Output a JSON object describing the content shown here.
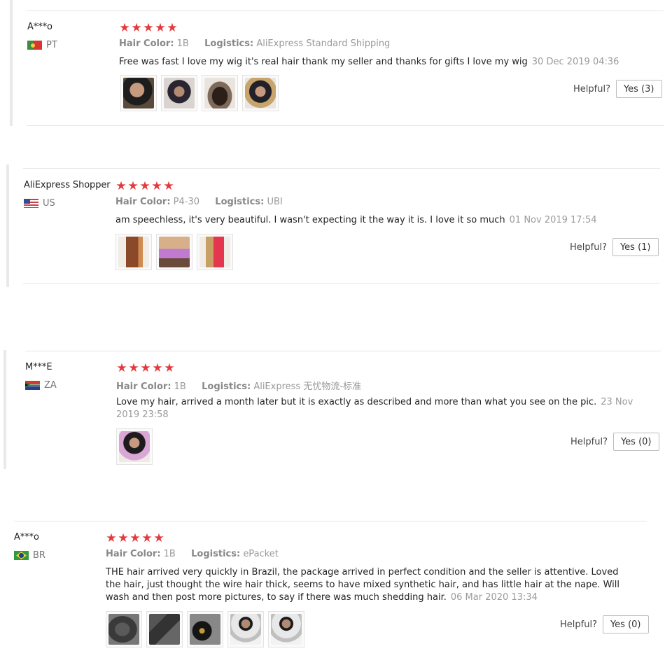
{
  "reviews": [
    {
      "user": "A***o",
      "country_code": "PT",
      "flag": "portugal-flag",
      "stars": 5,
      "attrs": [
        {
          "key": "Hair Color:",
          "value": "1B"
        },
        {
          "key": "Logistics:",
          "value": "AliExpress Standard Shipping"
        }
      ],
      "text": "Free was fast I love my wig it's real hair thank my seller and thanks for gifts I love my wig",
      "date": "30 Dec 2019 04:36",
      "photo_count": 4,
      "helpful_label": "Helpful?",
      "yes_label": "Yes (3)"
    },
    {
      "user": "AliExpress Shopper",
      "country_code": "US",
      "flag": "usa-flag",
      "stars": 5,
      "attrs": [
        {
          "key": "Hair Color:",
          "value": "P4-30"
        },
        {
          "key": "Logistics:",
          "value": "UBI"
        }
      ],
      "text": "am speechless, it's very beautiful. I wasn't expecting it the way it is. I love it so much",
      "date": "01 Nov 2019 17:54",
      "photo_count": 3,
      "helpful_label": "Helpful?",
      "yes_label": "Yes (1)"
    },
    {
      "user": "M***E",
      "country_code": "ZA",
      "flag": "south-africa-flag",
      "stars": 5,
      "attrs": [
        {
          "key": "Hair Color:",
          "value": "1B"
        },
        {
          "key": "Logistics:",
          "value": "AliExpress 无忧物流-标准"
        }
      ],
      "text": "Love my hair, arrived a month later but it is exactly as described and more than what you see on the pic.",
      "date": "23 Nov 2019 23:58",
      "photo_count": 1,
      "helpful_label": "Helpful?",
      "yes_label": "Yes (0)"
    },
    {
      "user": "A***o",
      "country_code": "BR",
      "flag": "brazil-flag",
      "stars": 5,
      "attrs": [
        {
          "key": "Hair Color:",
          "value": "1B"
        },
        {
          "key": "Logistics:",
          "value": "ePacket"
        }
      ],
      "text": "THE hair arrived very quickly in Brazil, the package arrived in perfect condition and the seller is attentive. Loved the hair, just thought the wire hair thick, seems to have mixed synthetic hair, and has little hair at the nape. Will wash and then post more pictures, to say if there was much shedding hair.",
      "date": "06 Mar 2020 13:34",
      "photo_count": 5,
      "helpful_label": "Helpful?",
      "yes_label": "Yes (0)"
    }
  ],
  "colors": {
    "star": "#e4393c",
    "date": "#9a9a9a",
    "border": "#e6e6e6"
  }
}
